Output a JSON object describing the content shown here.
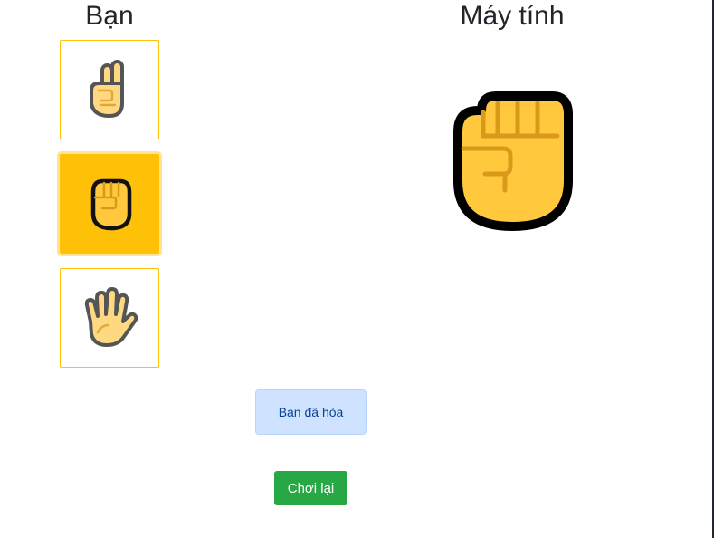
{
  "player": {
    "title": "Bạn",
    "choices": [
      {
        "icon": "victory-hand-icon",
        "selected": false
      },
      {
        "icon": "raised-fist-icon",
        "selected": true
      },
      {
        "icon": "raised-hand-icon",
        "selected": false
      }
    ]
  },
  "computer": {
    "title": "Máy tính",
    "choice_icon": "raised-fist-icon"
  },
  "result": {
    "text": "Bạn đã hòa"
  },
  "actions": {
    "replay_label": "Chơi lại"
  },
  "colors": {
    "accent": "#ffc107",
    "alert_bg": "#cfe2ff",
    "alert_text": "#084298",
    "button": "#28a745",
    "hand_light": "#ffd982",
    "hand_dark": "#ffc83d"
  }
}
